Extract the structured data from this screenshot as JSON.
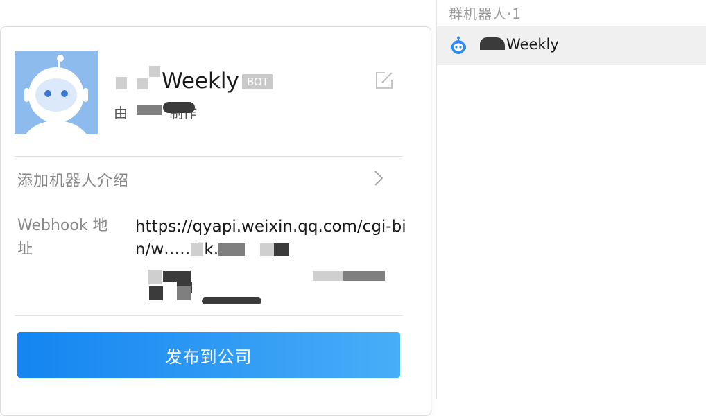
{
  "card": {
    "bot_name": "Weekly",
    "badge": "BOT",
    "maker": "由　　　制作",
    "intro_label": "添加机器人介绍",
    "webhook_label": "Webhook 地址",
    "webhook_url": "https://qyapi.weixin.qq.com/cgi-bin/w……?k……",
    "publish_button": "发布到公司"
  },
  "right_panel": {
    "header": "群机器人·1",
    "robots": [
      {
        "name": "Weekly"
      }
    ]
  },
  "colors": {
    "accent_start": "#1484f0",
    "accent_end": "#47aef8",
    "avatar_bg": "#8dbbee",
    "badge_bg": "#c9c9c9"
  },
  "icons": {
    "avatar": "robot-avatar-icon",
    "edit": "edit-icon",
    "chevron": "chevron-right-icon",
    "row_robot": "robot-icon"
  }
}
